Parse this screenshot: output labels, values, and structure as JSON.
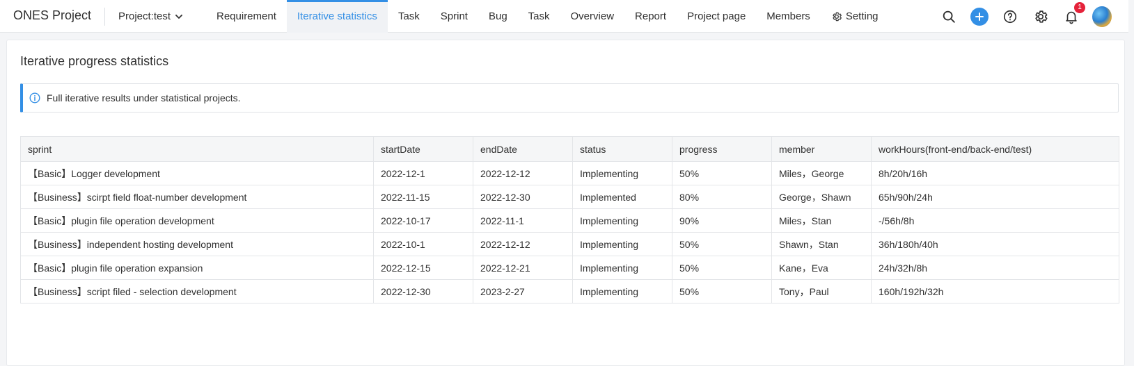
{
  "header": {
    "brand": "ONES Project",
    "project_label": "Project:test",
    "nav": [
      {
        "label": "Requirement"
      },
      {
        "label": "Iterative statistics"
      },
      {
        "label": "Task"
      },
      {
        "label": "Sprint"
      },
      {
        "label": "Bug"
      },
      {
        "label": "Task"
      },
      {
        "label": "Overview"
      },
      {
        "label": "Report"
      },
      {
        "label": "Project page"
      },
      {
        "label": "Members"
      },
      {
        "label": "Setting"
      }
    ],
    "active_nav": "Iterative statistics",
    "notification_count": "1",
    "accent_color": "#338fe5",
    "icons": [
      "search-icon",
      "plus-icon",
      "help-icon",
      "gear-icon",
      "bell-icon",
      "avatar"
    ]
  },
  "page": {
    "title": "Iterative progress statistics",
    "notice": "Full iterative results under statistical projects."
  },
  "table": {
    "columns": [
      "sprint",
      "startDate",
      "endDate",
      "status",
      "progress",
      "member",
      "workHours(front-end/back-end/test)"
    ],
    "rows": [
      [
        "【Basic】Logger development",
        "2022-12-1",
        "2022-12-12",
        "Implementing",
        "50%",
        "Miles，George",
        "8h/20h/16h"
      ],
      [
        "【Business】scirpt field float-number development",
        "2022-11-15",
        "2022-12-30",
        "Implemented",
        "80%",
        "George，Shawn",
        "65h/90h/24h"
      ],
      [
        "【Basic】plugin file operation development",
        "2022-10-17",
        "2022-11-1",
        "Implementing",
        "90%",
        "Miles，Stan",
        "-/56h/8h"
      ],
      [
        "【Business】independent hosting development",
        "2022-10-1",
        "2022-12-12",
        "Implementing",
        "50%",
        "Shawn，Stan",
        "36h/180h/40h"
      ],
      [
        "【Basic】plugin file operation expansion",
        "2022-12-15",
        "2022-12-21",
        "Implementing",
        "50%",
        "Kane，Eva",
        "24h/32h/8h"
      ],
      [
        "【Business】script filed - selection development",
        "2022-12-30",
        "2023-2-27",
        "Implementing",
        "50%",
        "Tony，Paul",
        "160h/192h/32h"
      ]
    ]
  }
}
